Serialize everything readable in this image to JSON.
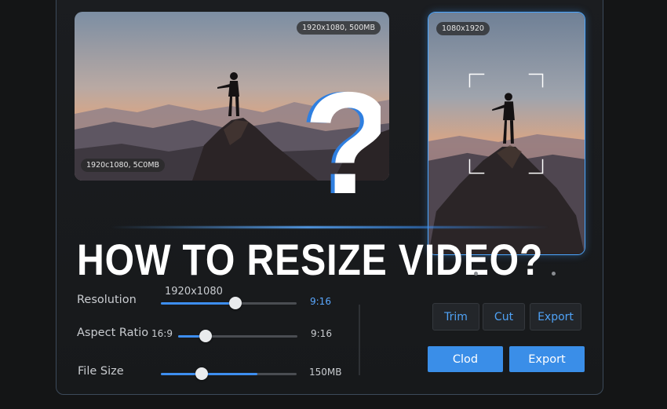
{
  "headline": "HOW TO RESIZE VIDEO?",
  "question_mark": "?",
  "preview": {
    "landscape_badge_top": "1920x1080, 500MB",
    "landscape_badge_bottom": "1920c1080, 5C0MB",
    "portrait_badge": "1080x1920"
  },
  "controls": {
    "resolution": {
      "label": "Resolution",
      "value_above": "1920x1080",
      "value_right": "9:16",
      "level": 0.55
    },
    "aspect_ratio": {
      "label": "Aspect Ratio",
      "value_left": "16:9",
      "value_right": "9:16",
      "level": 0.23
    },
    "file_size": {
      "label": "File Size",
      "value_right": "150MB",
      "level": 0.3,
      "fill_level": 0.71
    }
  },
  "actions": {
    "trim": "Trim",
    "cut": "Cut",
    "export_secondary": "Export",
    "clod": "Clod",
    "export_primary": "Export"
  },
  "colors": {
    "accent": "#3a8ee8",
    "accent_text": "#5aa8ff",
    "background": "#141516"
  }
}
